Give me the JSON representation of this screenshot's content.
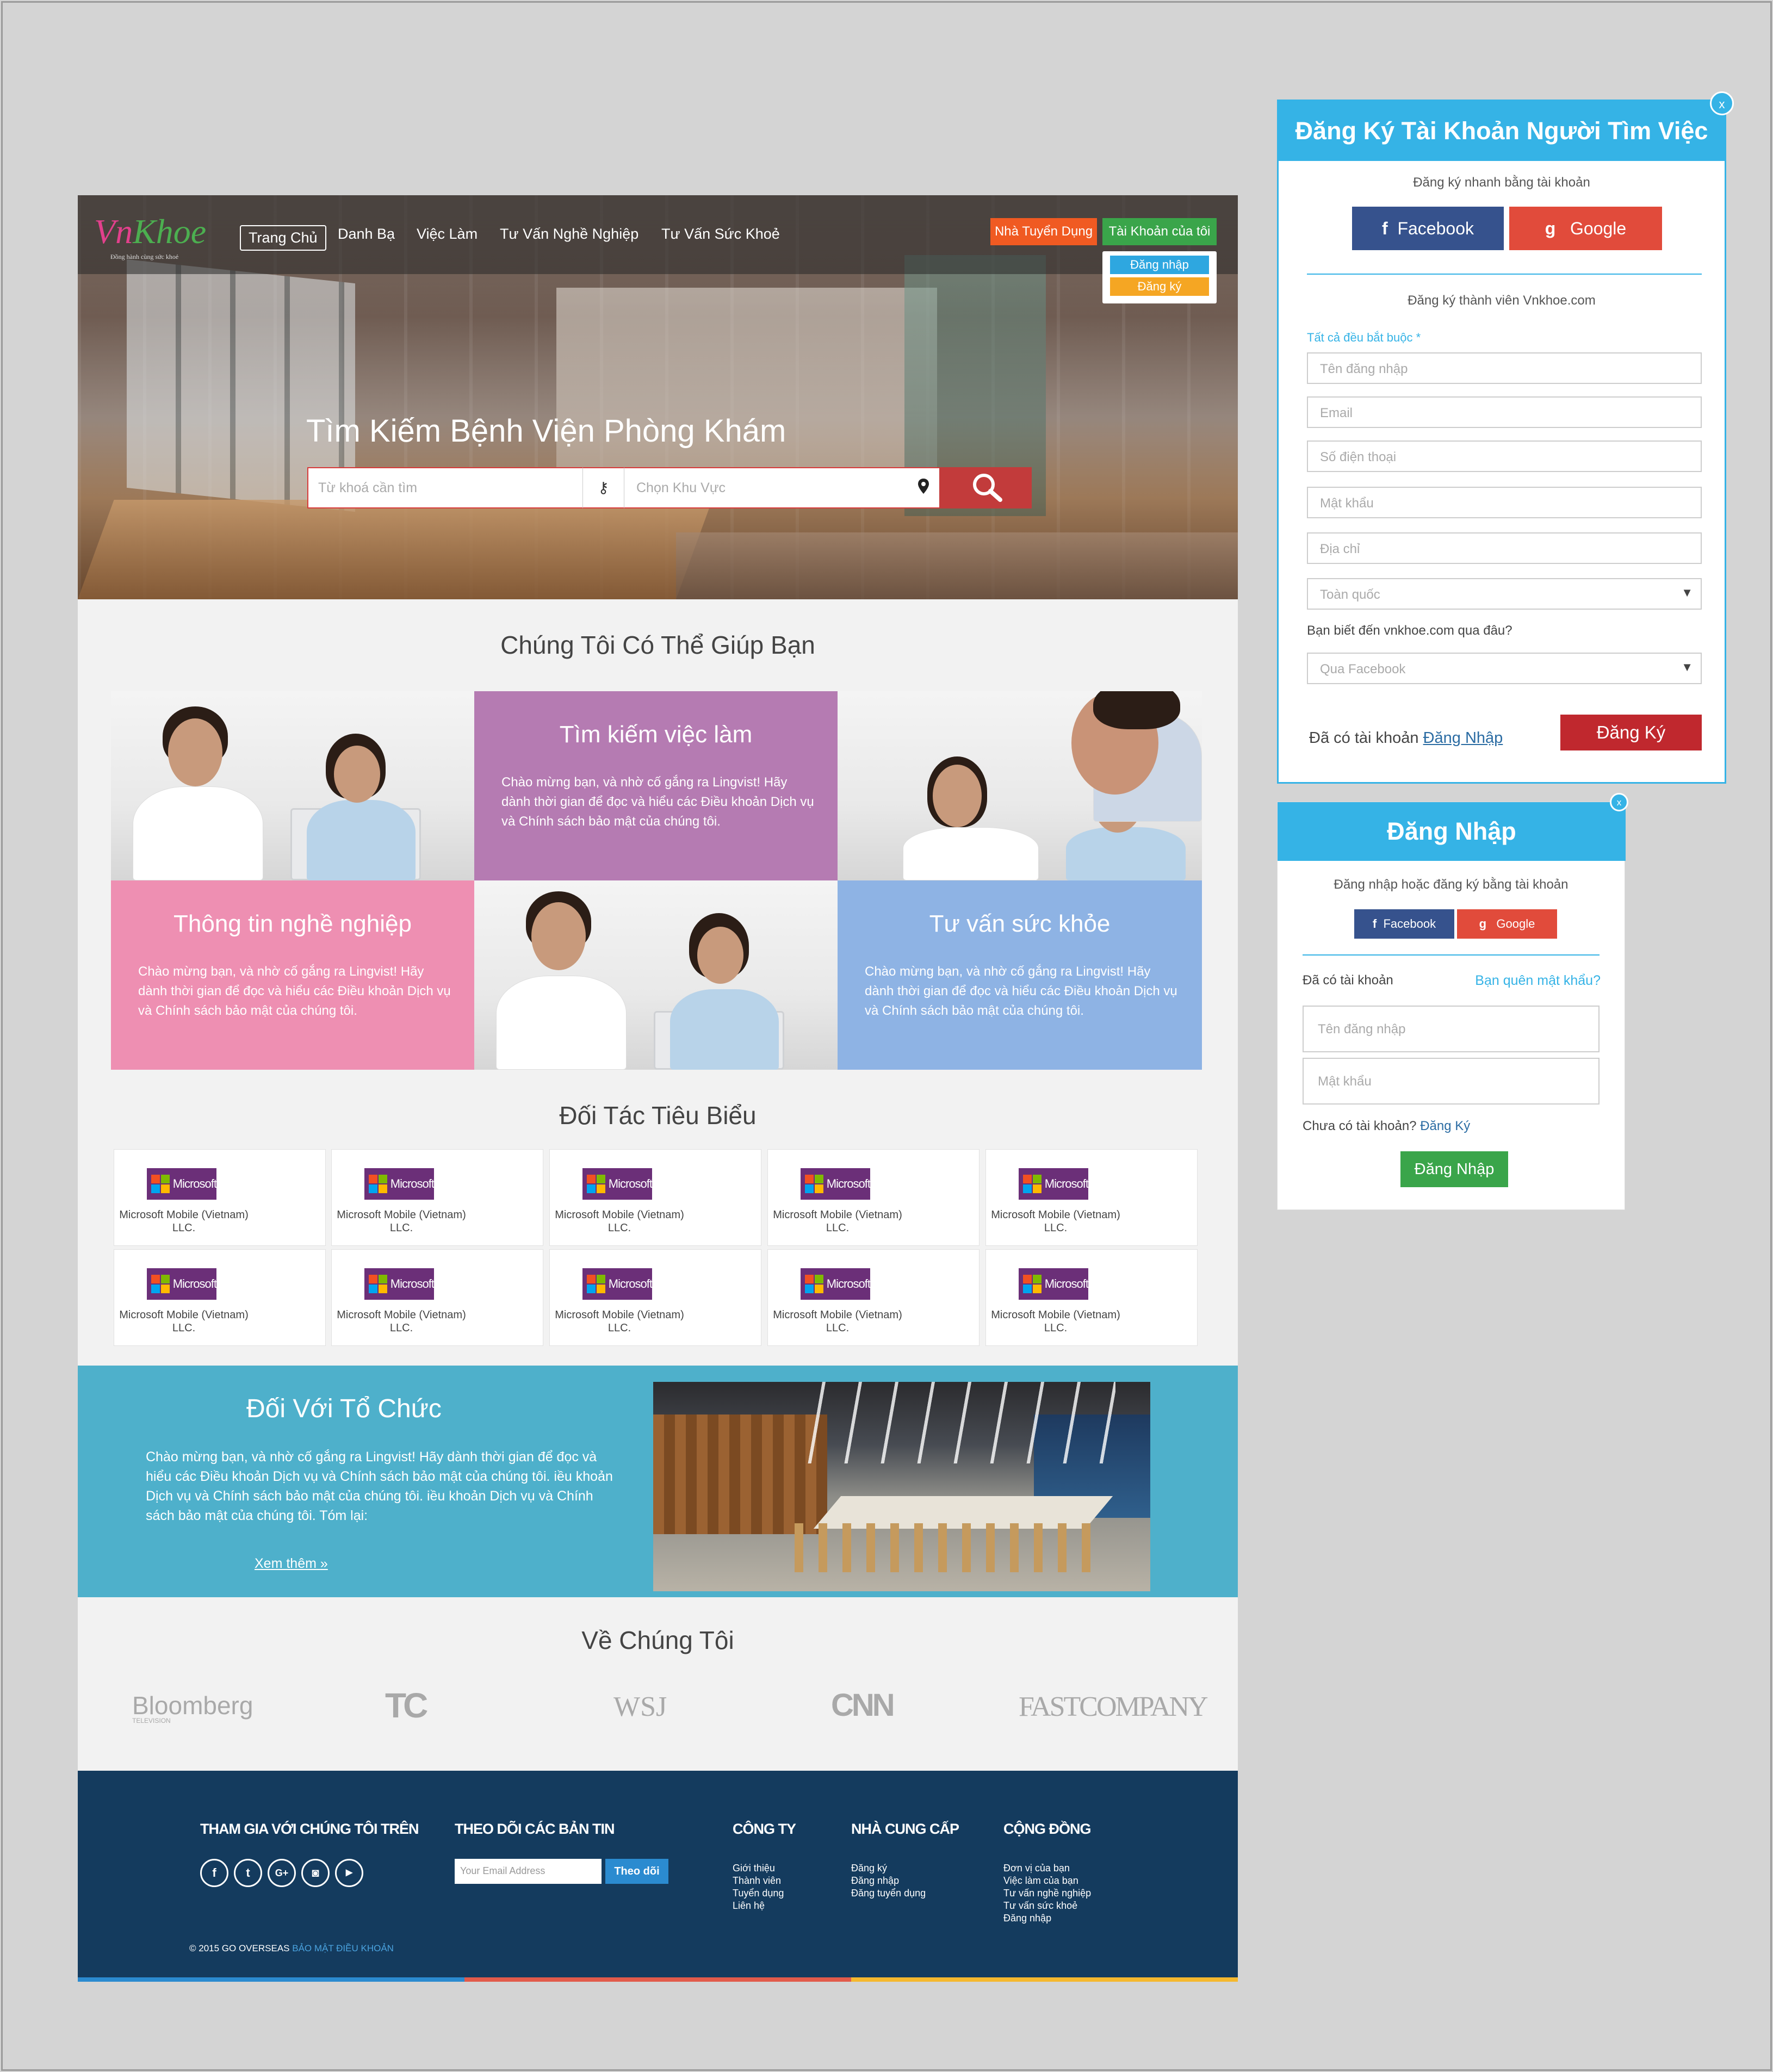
{
  "site": {
    "logo": {
      "part1": "Vn",
      "part2": "Khoe",
      "tagline": "Đồng hành cùng sức khoẻ"
    },
    "nav": [
      "Trang Chủ",
      "Danh Bạ",
      "Việc Làm",
      "Tư Vấn Nghề Nghiệp",
      "Tư Vấn Sức Khoẻ"
    ],
    "employer_button": "Nhà Tuyển Dụng",
    "account_button": "Tài Khoản của tôi",
    "account_menu": {
      "login": "Đăng nhập",
      "register": "Đăng ký"
    },
    "hero_title": "Tìm Kiếm Bệnh Viện Phòng Khám",
    "search": {
      "keyword_placeholder": "Từ khoá cần tìm",
      "area_placeholder": "Chọn Khu Vực"
    },
    "help": {
      "title": "Chúng Tôi Có Thể Giúp Bạn",
      "tiles": [
        {
          "title": "Tìm kiếm việc làm",
          "text": "Chào mừng bạn, và nhờ cố gắng ra Lingvist! Hãy dành thời gian để đọc và hiểu các Điều khoản Dịch vụ và Chính sách bảo mật của chúng tôi."
        },
        {
          "title": "Thông tin nghề nghiệp",
          "text": "Chào mừng bạn, và nhờ cố gắng ra Lingvist! Hãy dành thời gian để đọc và hiểu các Điều khoản Dịch vụ và Chính sách bảo mật của chúng tôi."
        },
        {
          "title": "Tư vấn sức khỏe",
          "text": "Chào mừng bạn, và nhờ cố gắng ra Lingvist! Hãy dành thời gian để đọc và hiểu các Điều khoản Dịch vụ và Chính sách bảo mật của chúng tôi."
        }
      ]
    },
    "partners": {
      "title": "Đối Tác Tiêu Biểu",
      "logo_text": "Microsoft",
      "items": [
        {
          "name": "Microsoft Mobile (Vietnam) LLC."
        },
        {
          "name": "Microsoft Mobile (Vietnam) LLC."
        },
        {
          "name": "Microsoft Mobile (Vietnam) LLC."
        },
        {
          "name": "Microsoft Mobile (Vietnam) LLC."
        },
        {
          "name": "Microsoft Mobile (Vietnam) LLC."
        },
        {
          "name": "Microsoft Mobile (Vietnam) LLC."
        },
        {
          "name": "Microsoft Mobile (Vietnam) LLC."
        },
        {
          "name": "Microsoft Mobile (Vietnam) LLC."
        },
        {
          "name": "Microsoft Mobile (Vietnam) LLC."
        },
        {
          "name": "Microsoft Mobile (Vietnam) LLC."
        }
      ]
    },
    "org": {
      "title": "Đối Với Tổ Chức",
      "text": "Chào mừng bạn, và nhờ cố gắng ra Lingvist! Hãy dành thời gian để đọc và hiểu các Điều khoản Dịch vụ và Chính sách bảo mật của chúng tôi. iều khoản Dịch vụ và Chính sách bảo mật của chúng tôi. iều khoản Dịch vụ và Chính sách bảo mật của chúng tôi. Tóm lại:",
      "more": "Xem thêm"
    },
    "about": {
      "title": "Về Chúng Tôi",
      "press": [
        "Bloomberg",
        "TC",
        "WSJ",
        "CNN",
        "FASTCOMPANY"
      ],
      "bloomberg_sub": "TELEVISION"
    },
    "footer": {
      "join": "THAM GIA VỚI CHÚNG TÔI TRÊN",
      "newsletter": "THEO DÕI CÁC BẢN TIN",
      "email_placeholder": "Your Email Address",
      "follow_button": "Theo dõi",
      "company": {
        "title": "CÔNG TY",
        "links": [
          "Giới thiệu",
          "Thành viên",
          "Tuyển dụng",
          "Liên hệ"
        ]
      },
      "supplier": {
        "title": "NHÀ CUNG CẤP",
        "links": [
          "Đăng ký",
          "Đăng nhập",
          "Đăng tuyển dụng"
        ]
      },
      "community": {
        "title": "CỘNG ĐỒNG",
        "links": [
          "Đơn vị của bạn",
          "Việc làm của bạn",
          "Tư vấn nghề nghiệp",
          "Tư vấn sức khoẻ",
          "Đăng nhập"
        ]
      },
      "copyright": "© 2015 GO OVERSEAS",
      "terms": "BẢO MẬT ĐIỀU KHOẢN"
    },
    "colors": {
      "primary": "#35b3e6",
      "footer": "#143b5e",
      "org": "#4eb0cb",
      "purple": "#b57bb2",
      "pink": "#ee8fb2",
      "blue": "#8eb3e4"
    }
  },
  "register": {
    "title": "Đăng Ký Tài Khoản Người Tìm Việc",
    "close": "x",
    "quick_label": "Đăng ký nhanh bằng tài khoản",
    "facebook": "Facebook",
    "google": "Google",
    "member_label": "Đăng ký thành viên Vnkhoe.com",
    "required_note": "Tất cả đều bắt buộc *",
    "fields": [
      "Tên đăng nhập",
      "Email",
      "Số điện thoại",
      "Mật khẩu",
      "Địa chỉ"
    ],
    "region_value": "Toàn quốc",
    "source_question": "Bạn biết đến vnkhoe.com qua đâu?",
    "source_value": "Qua Facebook",
    "have_account": "Đã có tài khoản",
    "login_link": "Đăng Nhập",
    "submit": "Đăng Ký"
  },
  "login": {
    "title": "Đăng Nhập",
    "close": "x",
    "quick_label": "Đăng nhập hoặc đăng ký bằng tài khoản",
    "facebook": "Facebook",
    "google": "Google",
    "have_account": "Đã có tài khoản",
    "forgot": "Bạn quên mật khẩu?",
    "username_placeholder": "Tên đăng nhập",
    "password_placeholder": "Mật khẩu",
    "no_account": "Chưa có tài khoản?",
    "register_link": "Đăng Ký",
    "submit": "Đăng Nhập"
  }
}
